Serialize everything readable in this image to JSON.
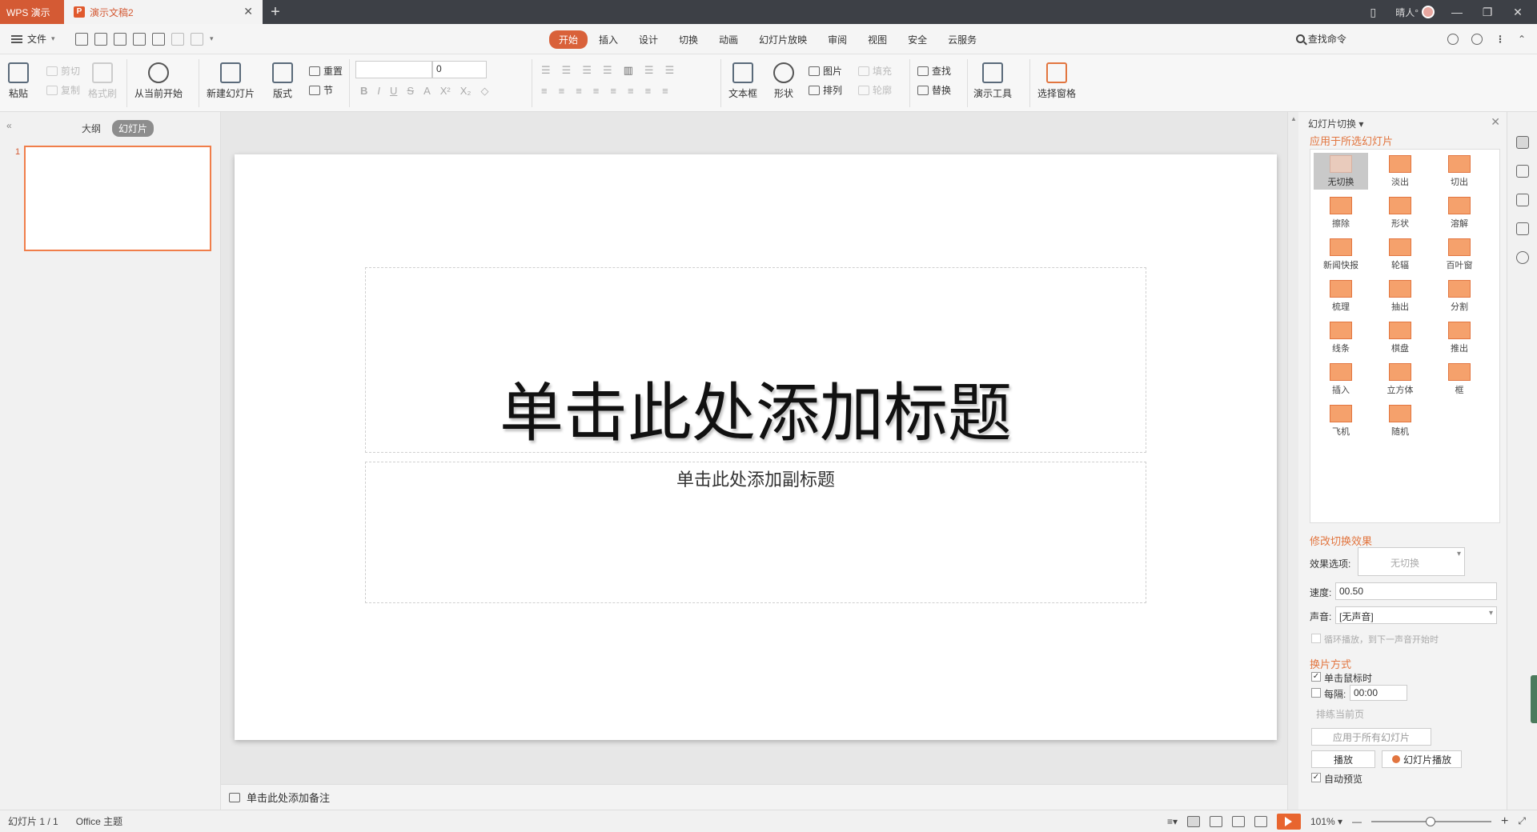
{
  "titlebar": {
    "app_name": "WPS 演示",
    "doc_name": "演示文稿2",
    "user_name": "晴人°"
  },
  "menubar": {
    "file_label": "文件",
    "tabs": [
      "开始",
      "插入",
      "设计",
      "切换",
      "动画",
      "幻灯片放映",
      "审阅",
      "视图",
      "安全",
      "云服务"
    ],
    "active_tab": "开始",
    "search_label": "查找命令"
  },
  "ribbon": {
    "paste": "粘贴",
    "cut": "剪切",
    "copy": "复制",
    "format_painter": "格式刷",
    "from_current": "从当前开始",
    "new_slide": "新建幻灯片",
    "layout": "版式",
    "reset": "重置",
    "section": "节",
    "font_size": "0",
    "textbox": "文本框",
    "shape": "形状",
    "picture": "图片",
    "arrange": "排列",
    "fill": "填充",
    "outline": "轮廓",
    "find": "查找",
    "replace": "替换",
    "presenter_tools": "演示工具",
    "selection_pane": "选择窗格"
  },
  "leftpanel": {
    "outline_tab": "大纲",
    "slides_tab": "幻灯片",
    "slide_number": "1"
  },
  "slide": {
    "title_placeholder": "单击此处添加标题",
    "subtitle_placeholder": "单击此处添加副标题"
  },
  "notes": {
    "placeholder": "单击此处添加备注"
  },
  "taskpane": {
    "header": "幻灯片切换",
    "apply_label": "应用于所选幻灯片",
    "transitions": [
      "无切换",
      "淡出",
      "切出",
      "擦除",
      "形状",
      "溶解",
      "新闻快报",
      "轮辐",
      "百叶窗",
      "梳理",
      "抽出",
      "分割",
      "线条",
      "棋盘",
      "推出",
      "插入",
      "立方体",
      "框",
      "飞机",
      "随机"
    ],
    "active_transition": "无切换",
    "modify_label": "修改切换效果",
    "effect_option_label": "效果选项:",
    "effect_option_value": "无切换",
    "speed_label": "速度:",
    "speed_value": "00.50",
    "sound_label": "声音:",
    "sound_value": "[无声音]",
    "loop_label": "循环播放，到下一声音开始时",
    "advance_label": "换片方式",
    "on_click_label": "单击鼠标时",
    "every_label": "每隔:",
    "every_value": "00:00",
    "row_partial": "排练当前页",
    "apply_all": "应用于所有幻灯片",
    "play": "播放",
    "slideshow": "幻灯片播放",
    "auto_preview": "自动预览"
  },
  "statusbar": {
    "slide_info": "幻灯片 1 / 1",
    "theme": "Office 主题",
    "zoom": "101%"
  }
}
